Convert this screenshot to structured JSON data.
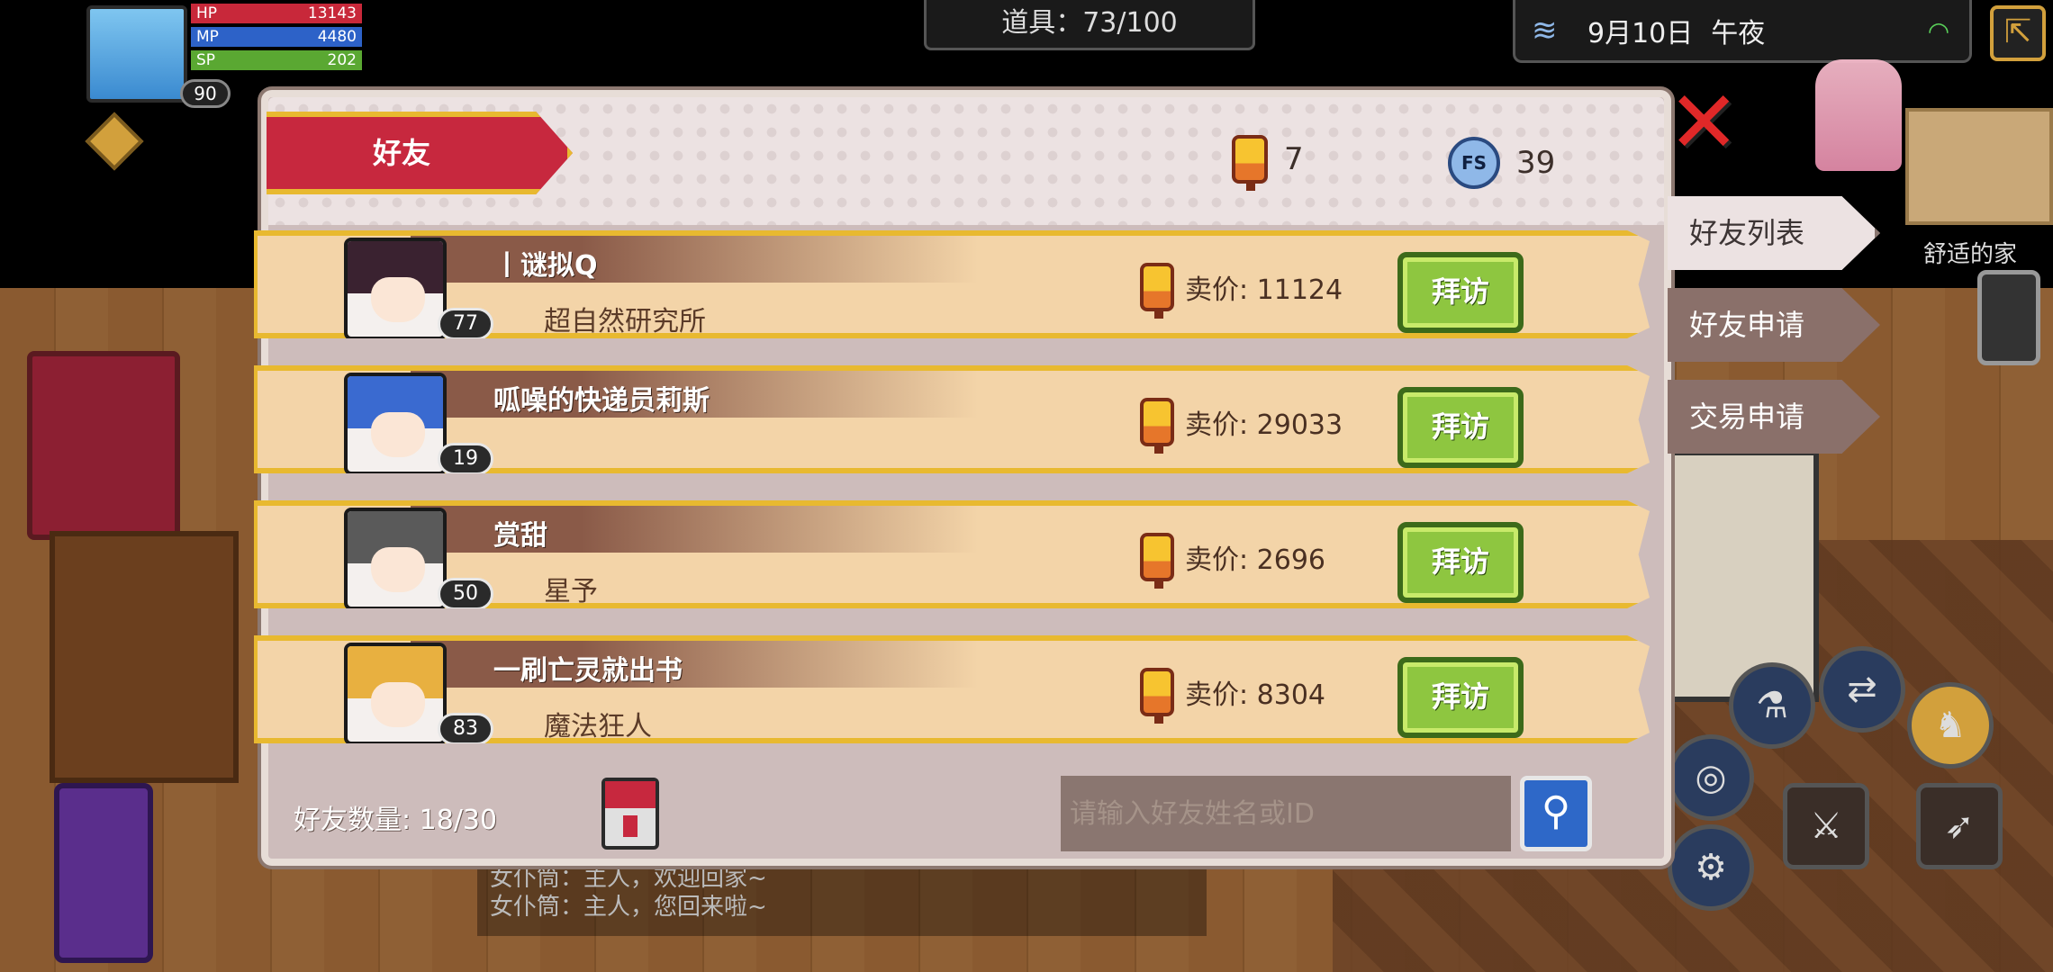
{
  "hud": {
    "hp_label": "HP",
    "hp_value": "13143",
    "mp_label": "MP",
    "mp_value": "4480",
    "sp_label": "SP",
    "sp_value": "202",
    "player_level": "90",
    "items": "道具：73/100",
    "date": "9月10日",
    "time_of_day": "午夜",
    "location": "舒适的家"
  },
  "dialog": {
    "title": "好友",
    "currency_lantern": "7",
    "currency_fs": "39",
    "fs_icon_text": "FS",
    "friend_count": "好友数量: 18/30",
    "search_placeholder": "请输入好友姓名或ID"
  },
  "side_tabs": [
    {
      "label": "好友列表",
      "active": true
    },
    {
      "label": "好友申请",
      "active": false
    },
    {
      "label": "交易申请",
      "active": false
    }
  ],
  "friends": [
    {
      "name": "丨谜拟Q",
      "level": "77",
      "guild": "超自然研究所",
      "price": "卖价: 11124",
      "visit": "拜访"
    },
    {
      "name": "呱噪的快递员莉斯",
      "level": "19",
      "guild": "",
      "price": "卖价: 29033",
      "visit": "拜访"
    },
    {
      "name": "赏甜",
      "level": "50",
      "guild": "星予",
      "price": "卖价: 2696",
      "visit": "拜访"
    },
    {
      "name": "一刷亡灵就出书",
      "level": "83",
      "guild": "魔法狂人",
      "price": "卖价: 8304",
      "visit": "拜访"
    }
  ],
  "chat_log": [
    "女仆筒：主人，欢迎回家~",
    "女仆筒：主人，您回来啦~"
  ],
  "icons": {
    "lantern": "lantern-currency-icon",
    "fs": "fs-coin-icon",
    "search": "magnifier-icon",
    "close": "red-x-icon"
  },
  "colors": {
    "title_red": "#c7283e",
    "gold_border": "#e8b930",
    "visit_green": "#8ec640",
    "row_bg": "#f3d4a8"
  }
}
